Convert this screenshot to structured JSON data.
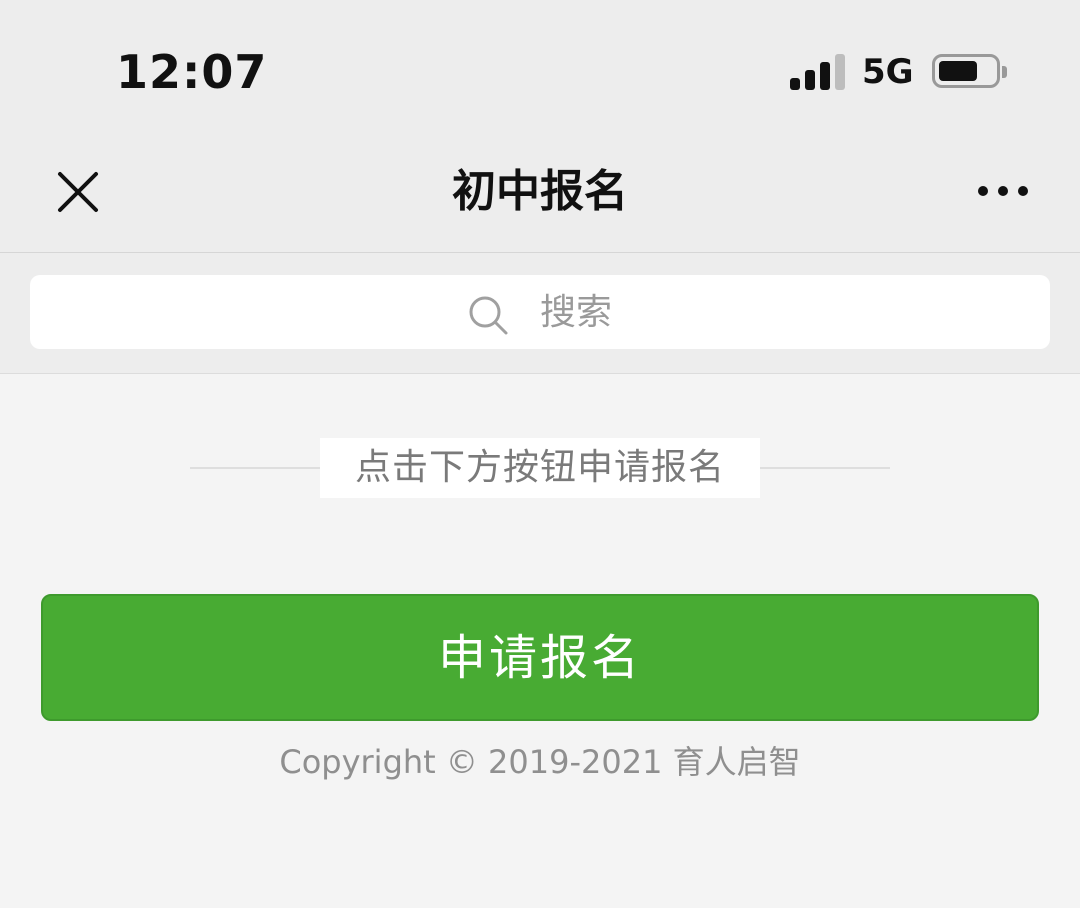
{
  "status_bar": {
    "time": "12:07",
    "network": "5G",
    "signal_bars": 3,
    "signal_total": 4,
    "battery_level": 0.7
  },
  "nav": {
    "title": "初中报名",
    "close_icon": "close-icon",
    "more_icon": "more-icon"
  },
  "search": {
    "placeholder": "搜索",
    "icon": "search-icon"
  },
  "content": {
    "hint": "点击下方按钮申请报名",
    "apply_button_label": "申请报名",
    "copyright": "Copyright © 2019-2021 育人启智"
  },
  "colors": {
    "primary_button": "#48ab33",
    "header_background": "#ededed",
    "page_background": "#f4f4f4"
  }
}
